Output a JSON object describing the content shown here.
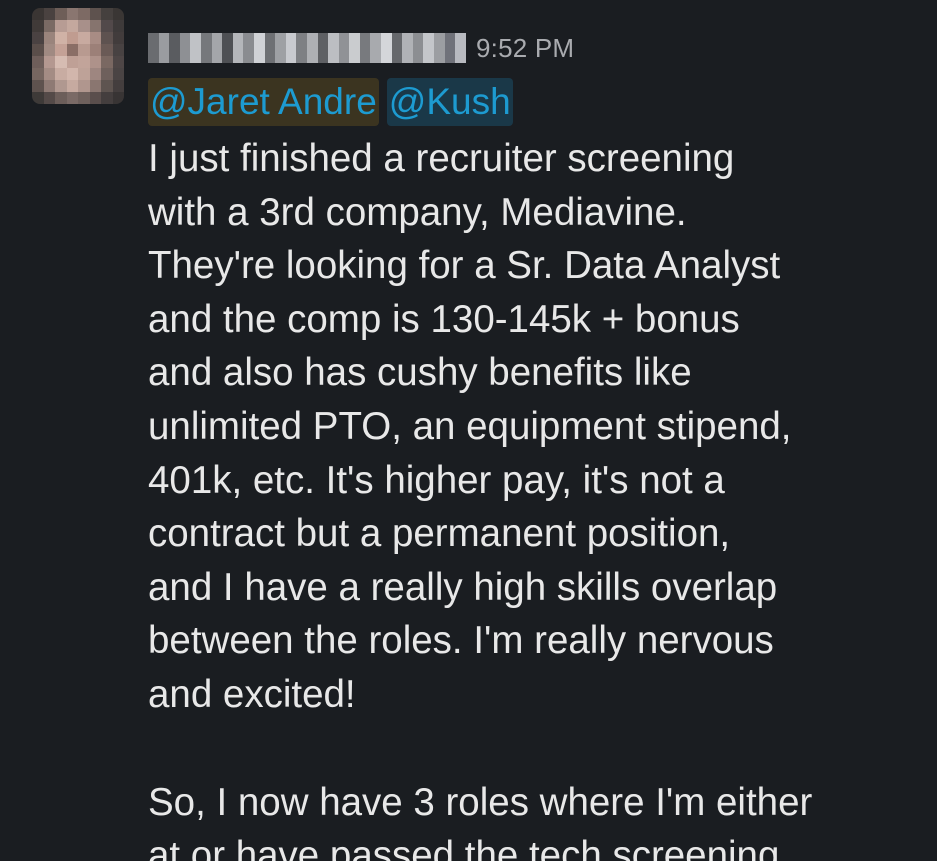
{
  "message": {
    "timestamp": "9:52 PM",
    "mentions": [
      "@Jaret Andre",
      "@Kush"
    ],
    "paragraph1_lines": [
      "I just finished a recruiter screening",
      "with a 3rd company, Mediavine.",
      "They're looking for a Sr. Data Analyst",
      "and the comp is 130-145k + bonus",
      "and also has cushy benefits like",
      "unlimited PTO, an equipment stipend,",
      "401k, etc. It's higher pay, it's not a",
      "contract but a permanent position,",
      "and I have a really high skills overlap",
      "between the roles. I'm really nervous",
      "and excited!"
    ],
    "paragraph2_lines": [
      "So, I now have 3 roles where I'm either",
      "at or have passed the tech screening."
    ]
  },
  "colors": {
    "background": "#1a1d21",
    "text": "#e8e8e8",
    "timestamp": "#a9abaf",
    "mention_link": "#1d9bd1",
    "mention_self_bg": "#3b3420",
    "mention_other_bg": "#1a3848"
  }
}
